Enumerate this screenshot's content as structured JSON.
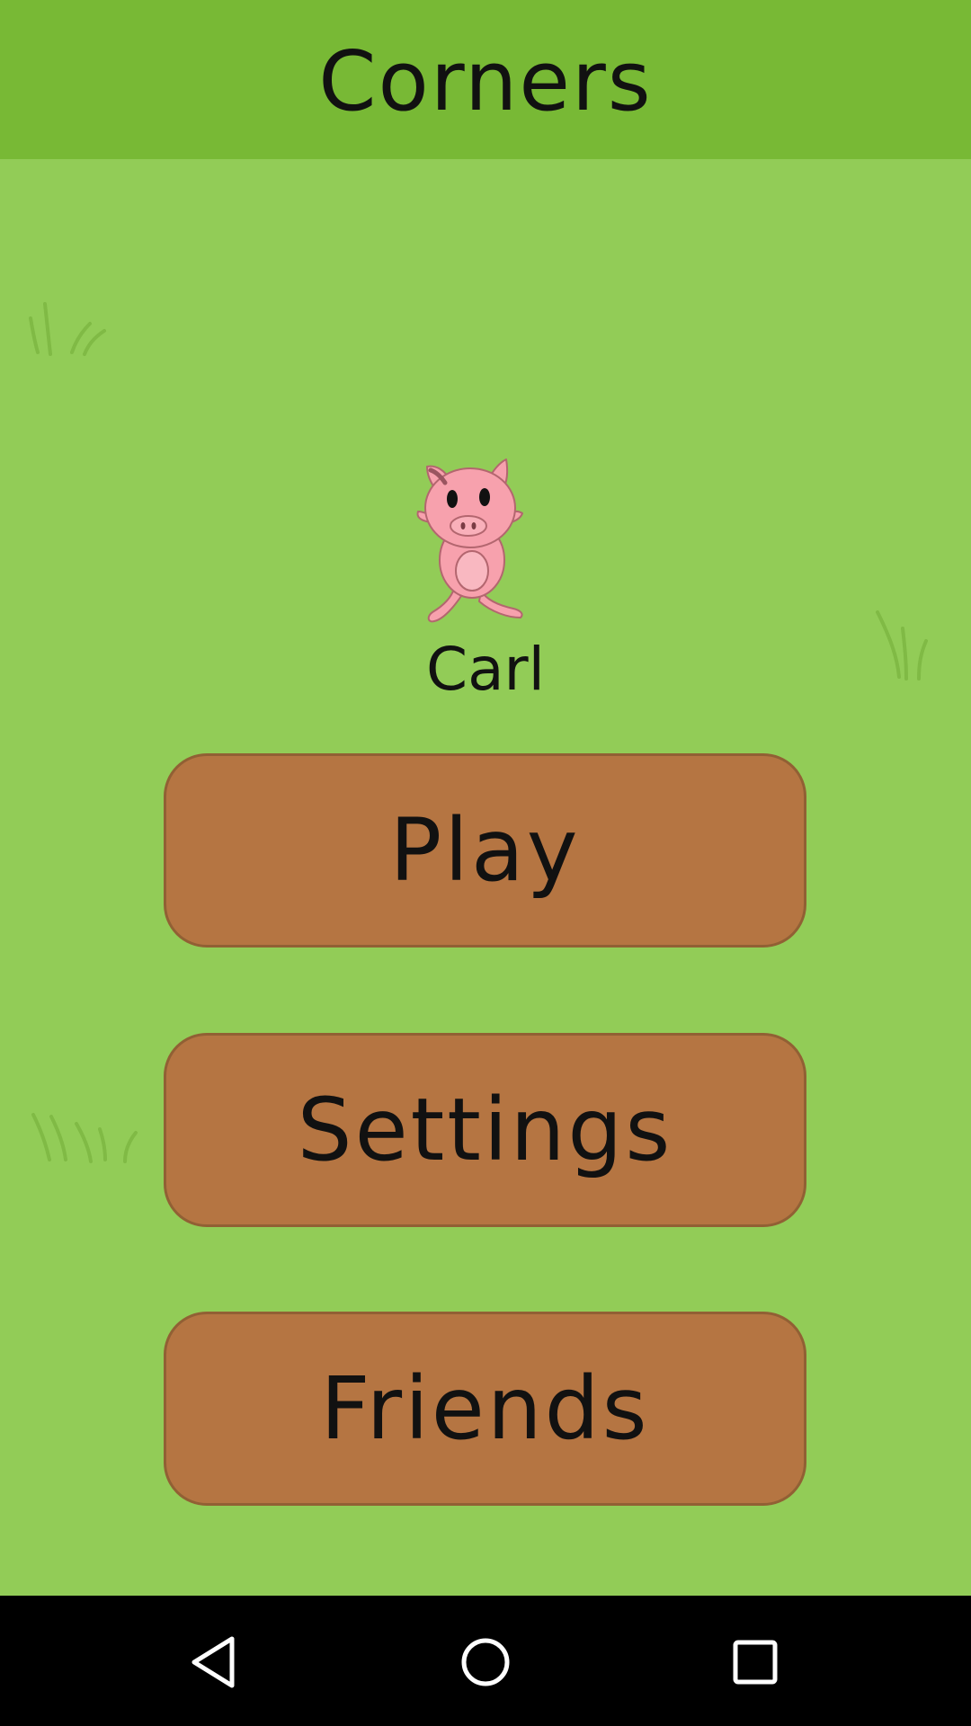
{
  "app": {
    "title": "Corners"
  },
  "character": {
    "name": "Carl",
    "icon": "pig-icon"
  },
  "menu": {
    "play_label": "Play",
    "settings_label": "Settings",
    "friends_label": "Friends"
  },
  "navbar": {
    "back_icon": "back-triangle-icon",
    "home_icon": "home-circle-icon",
    "recent_icon": "recents-square-icon"
  },
  "colors": {
    "appbar": "#78b935",
    "background": "#92cc57",
    "button": "#b57542",
    "button_border": "#916034",
    "pig": "#f7a1ad"
  }
}
